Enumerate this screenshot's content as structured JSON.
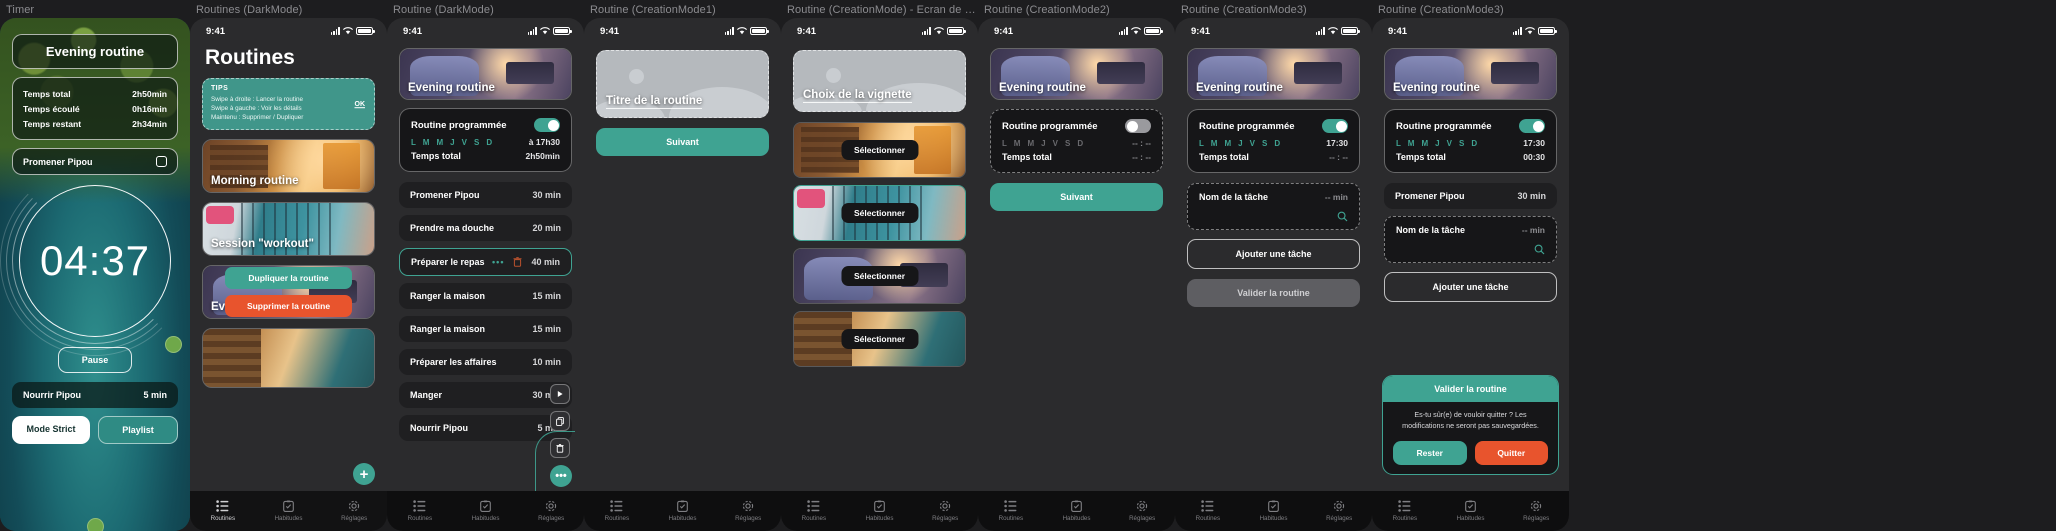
{
  "frames": [
    {
      "title": "Timer"
    },
    {
      "title": "Routines (DarkMode)"
    },
    {
      "title": "Routine (DarkMode)"
    },
    {
      "title": "Routine (CreationMode1)"
    },
    {
      "title": "Routine (CreationMode) - Ecran de sélecti..."
    },
    {
      "title": "Routine (CreationMode2)"
    },
    {
      "title": "Routine (CreationMode3)"
    },
    {
      "title": "Routine (CreationMode3)"
    }
  ],
  "status_bar": {
    "time": "9:41"
  },
  "timer": {
    "routine_title": "Evening routine",
    "stats": [
      {
        "label": "Temps total",
        "value": "2h50min"
      },
      {
        "label": "Temps écoulé",
        "value": "0h16min"
      },
      {
        "label": "Temps restant",
        "value": "2h34min"
      }
    ],
    "current_task": "Promener Pipou",
    "countdown": "04:37",
    "pause_label": "Pause",
    "next_task": {
      "label": "Nourrir Pipou",
      "value": "5 min"
    },
    "strict_mode_label": "Mode Strict",
    "playlist_label": "Playlist"
  },
  "routines_list": {
    "heading": "Routines",
    "tips": {
      "heading": "TIPS",
      "lines": [
        "Swipe à droite : Lancer la routine",
        "Swipe à gauche : Voir les détails",
        "Maintenu : Supprimer / Dupliquer"
      ],
      "ok_label": "OK"
    },
    "cards": [
      {
        "label": "Morning routine"
      },
      {
        "label": "Session \"workout\""
      },
      {
        "label": "Evening routine"
      },
      {
        "label": ""
      }
    ],
    "context_menu": {
      "duplicate_label": "Dupliquer la routine",
      "delete_label": "Supprimer la routine"
    },
    "fab_label": "+"
  },
  "routine_detail": {
    "hero_label": "Evening routine",
    "schedule": {
      "title": "Routine programmée",
      "days": "L M M J V S D",
      "time": "à 17h30",
      "total_label": "Temps total",
      "total_value": "2h50min",
      "toggle": "on"
    },
    "tasks": [
      {
        "label": "Promener Pipou",
        "value": "30 min"
      },
      {
        "label": "Prendre ma douche",
        "value": "20 min"
      },
      {
        "label": "Préparer le repas",
        "value": "40 min",
        "selected": true
      },
      {
        "label": "Ranger la maison",
        "value": "15 min"
      },
      {
        "label": "Ranger la maison",
        "value": "15 min"
      },
      {
        "label": "Préparer les affaires",
        "value": "10 min"
      },
      {
        "label": "Manger",
        "value": "30 min"
      },
      {
        "label": "Nourrir Pipou",
        "value": "5 min"
      }
    ],
    "radial_more": "•••"
  },
  "creation1": {
    "vignette_label": "Titre de la routine",
    "next_label": "Suivant"
  },
  "creation_select": {
    "vignette_label": "Choix de la vignette",
    "select_label": "Sélectionner",
    "thumbs": [
      {
        "label": "Sélectionner"
      },
      {
        "label": "Sélectionner"
      },
      {
        "label": "Sélectionner"
      },
      {
        "label": "Sélectionner"
      }
    ]
  },
  "creation2": {
    "hero_label": "Evening routine",
    "schedule": {
      "title": "Routine programmée",
      "days": "L M M J V S D",
      "time": "-- : --",
      "total_label": "Temps total",
      "total_value": "-- : --",
      "toggle": "off"
    },
    "next_label": "Suivant"
  },
  "creation3a": {
    "hero_label": "Evening routine",
    "schedule": {
      "title": "Routine programmée",
      "days": "L M M J V S D",
      "time": "17:30",
      "total_label": "Temps total",
      "total_value": "-- : --",
      "toggle": "on"
    },
    "task_placeholder": {
      "label": "Nom de la tâche",
      "value": "-- min"
    },
    "add_task_label": "Ajouter une tâche",
    "validate_label": "Valider la routine"
  },
  "creation3b": {
    "hero_label": "Evening routine",
    "schedule": {
      "title": "Routine programmée",
      "days": "L M M J V S D",
      "time": "17:30",
      "total_label": "Temps total",
      "total_value": "00:30",
      "toggle": "on"
    },
    "task": {
      "label": "Promener Pipou",
      "value": "30 min"
    },
    "task_placeholder": {
      "label": "Nom de la tâche",
      "value": "-- min"
    },
    "add_task_label": "Ajouter une tâche",
    "validate_label": "Valider la routine",
    "confirm": {
      "title": "Valider la routine",
      "message": "Es-tu sûr(e) de vouloir quitter ? Les modifications ne seront pas sauvegardées.",
      "stay_label": "Rester",
      "quit_label": "Quitter"
    }
  },
  "tabbar": {
    "items": [
      {
        "label": "Routines",
        "icon": "list-icon"
      },
      {
        "label": "Habitudes",
        "icon": "checklist-icon"
      },
      {
        "label": "Réglages",
        "icon": "gear-icon"
      }
    ]
  },
  "colors": {
    "accent": "#3fa392",
    "danger": "#e8542d",
    "surface": "#1f1f21",
    "bg": "#2b2b2d"
  }
}
